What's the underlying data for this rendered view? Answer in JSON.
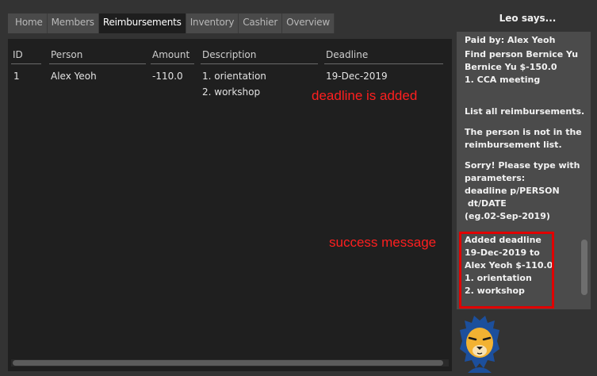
{
  "tabs": [
    {
      "label": "Home",
      "active": false
    },
    {
      "label": "Members",
      "active": false
    },
    {
      "label": "Reimbursements",
      "active": true
    },
    {
      "label": "Inventory",
      "active": false
    },
    {
      "label": "Cashier",
      "active": false
    },
    {
      "label": "Overview",
      "active": false
    }
  ],
  "table": {
    "columns": [
      "ID",
      "Person",
      "Amount",
      "Description",
      "Deadline"
    ],
    "rows": [
      {
        "id": "1",
        "person": "Alex Yeoh",
        "amount": "-110.0",
        "description": [
          "1. orientation",
          "2. workshop"
        ],
        "deadline": "19-Dec-2019"
      }
    ]
  },
  "annotations": {
    "deadline_added": "deadline is added",
    "success_message": "success message",
    "color": "#ff1f1f"
  },
  "chat": {
    "header": "Leo says...",
    "messages": [
      [
        "Paid by: Alex Yeoh"
      ],
      [
        "Find person Bernice Yu",
        "Bernice Yu $-150.0",
        "1. CCA meeting"
      ],
      [
        "List all reimbursements."
      ],
      [
        "The person is not in the",
        "reimbursement list."
      ],
      [
        "Sorry! Please type with",
        "parameters:",
        "deadline p/PERSON",
        " dt/DATE",
        "(eg.02-Sep-2019)"
      ],
      [
        "Added deadline",
        "19-Dec-2019 to",
        "Alex Yeoh $-110.0",
        "1. orientation",
        "2. workshop"
      ]
    ]
  },
  "mascot": {
    "icon": "lion-mascot-icon"
  },
  "colors": {
    "background": "#333333",
    "panel": "#1f1f1f",
    "chat_panel": "#4b4b4b",
    "highlight_border": "#e00000"
  }
}
